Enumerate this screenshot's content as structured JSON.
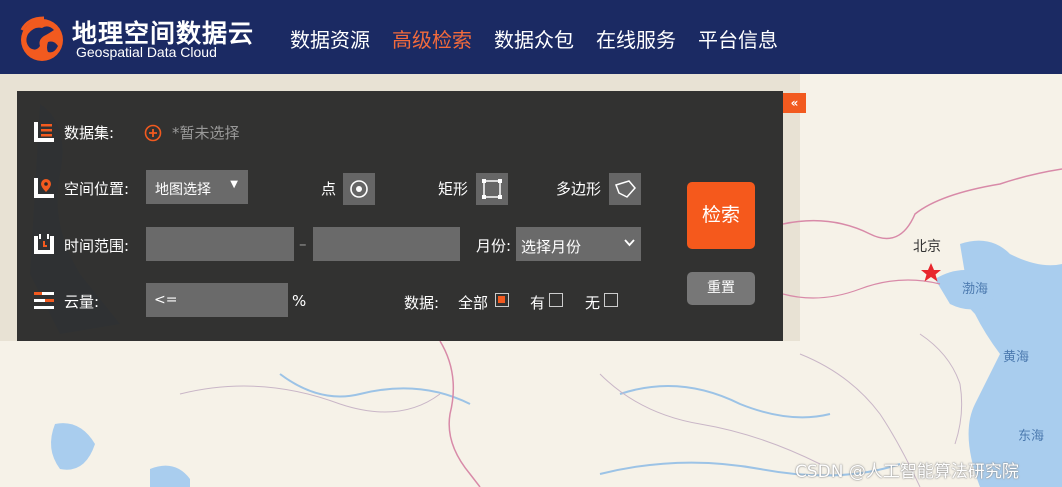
{
  "header": {
    "logo_cn": "地理空间数据云",
    "logo_en": "Geospatial Data Cloud",
    "nav": [
      {
        "label": "数据资源",
        "active": false
      },
      {
        "label": "高级检索",
        "active": true
      },
      {
        "label": "数据众包",
        "active": false
      },
      {
        "label": "在线服务",
        "active": false
      },
      {
        "label": "平台信息",
        "active": false
      }
    ]
  },
  "panel": {
    "collapse_label": "«",
    "dataset": {
      "label": "数据集:",
      "value": "*暂未选择"
    },
    "location": {
      "label": "空间位置:",
      "select_value": "地图选择",
      "point_label": "点",
      "rect_label": "矩形",
      "polygon_label": "多边形"
    },
    "time": {
      "label": "时间范围:",
      "start": "",
      "separator": "–",
      "end": "",
      "month_label": "月份:",
      "month_value": "选择月份"
    },
    "cloud": {
      "label": "云量:",
      "value": "<=",
      "unit": "%"
    },
    "data_filter": {
      "label": "数据:",
      "options": [
        {
          "label": "全部",
          "checked": true
        },
        {
          "label": "有",
          "checked": false
        },
        {
          "label": "无",
          "checked": false
        }
      ]
    },
    "search_label": "检索",
    "reset_label": "重置"
  },
  "map": {
    "labels": {
      "beijing": "北京",
      "bohai": "渤海",
      "huanghai": "黄海",
      "donghai": "东海"
    },
    "colors": {
      "land": "#f6f2e8",
      "water": "#a9cdee",
      "border": "#d88aa8"
    }
  },
  "watermark": "CSDN @人工智能算法研究院"
}
